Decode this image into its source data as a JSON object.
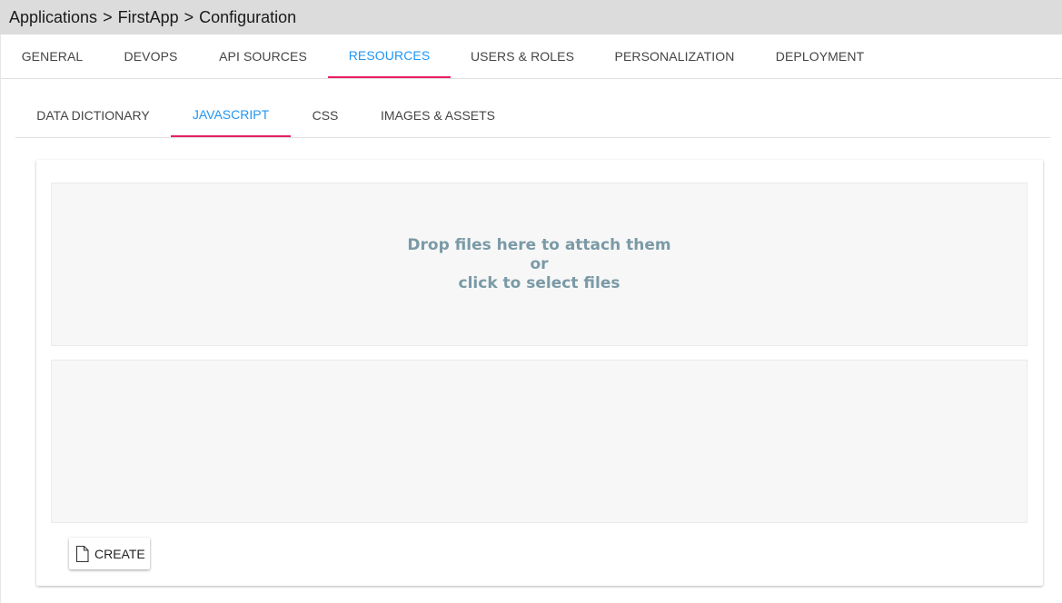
{
  "breadcrumb": {
    "items": [
      "Applications",
      "FirstApp",
      "Configuration"
    ],
    "separator": ">"
  },
  "main_tabs": [
    {
      "label": "GENERAL"
    },
    {
      "label": "DEVOPS"
    },
    {
      "label": "API SOURCES"
    },
    {
      "label": "RESOURCES",
      "active": true
    },
    {
      "label": "USERS & ROLES"
    },
    {
      "label": "PERSONALIZATION"
    },
    {
      "label": "DEPLOYMENT"
    }
  ],
  "sub_tabs": [
    {
      "label": "DATA DICTIONARY"
    },
    {
      "label": "JAVASCRIPT",
      "active": true
    },
    {
      "label": "CSS"
    },
    {
      "label": "IMAGES & ASSETS"
    }
  ],
  "dropzone": {
    "line1": "Drop files here to attach them",
    "line2": "or",
    "line3": "click to select files"
  },
  "create_button": {
    "label": "CREATE",
    "icon": "file-icon"
  },
  "colors": {
    "accent_text": "#2196f3",
    "active_underline": "#e91e63",
    "dropzone_text": "#7a9aa6",
    "breadcrumb_bg": "#dcdcdc"
  }
}
